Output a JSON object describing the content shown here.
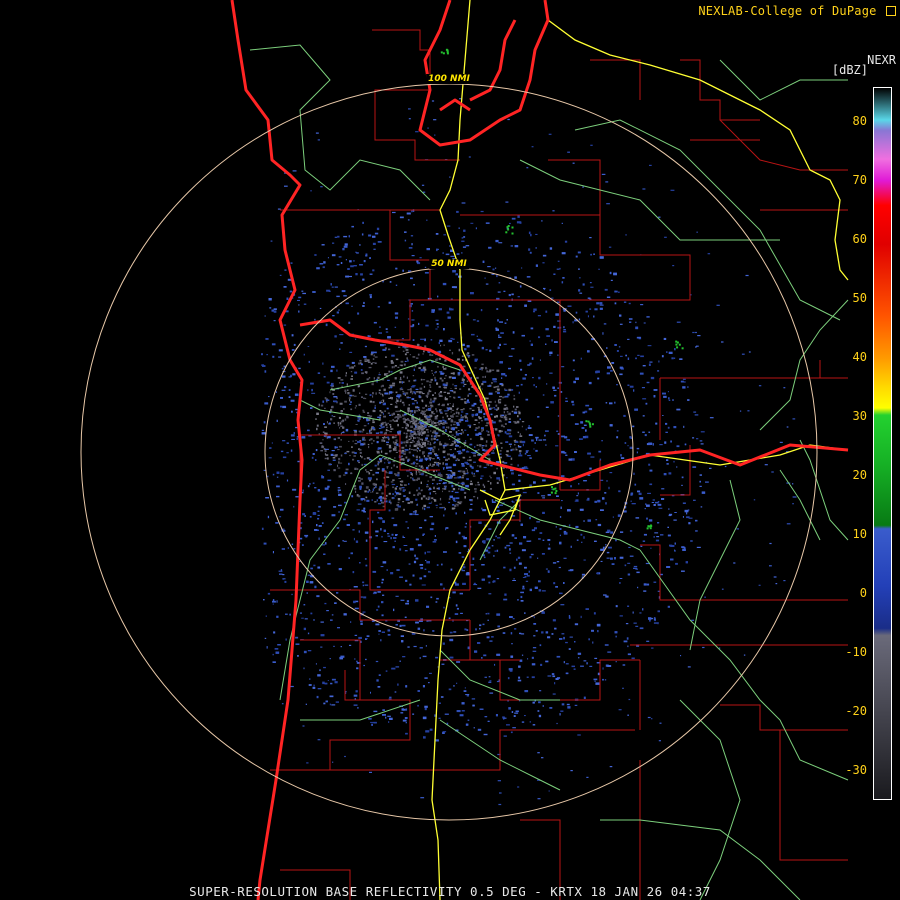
{
  "credit": "NEXLAB-College of DuPage",
  "credit_icon": "external-link-icon",
  "product_code": "NEXR",
  "unit": "[dBZ]",
  "caption": "SUPER-RESOLUTION BASE REFLECTIVITY 0.5 DEG - KRTX 18 JAN 26 04:37",
  "range_rings": [
    {
      "label": "100 NMI"
    },
    {
      "label": "50 NMI"
    }
  ],
  "colorbar_ticks": [
    "80",
    "70",
    "60",
    "50",
    "40",
    "30",
    "20",
    "10",
    "0",
    "-10",
    "-20",
    "-30"
  ],
  "colors": {
    "state_county_borders": "#cc1111",
    "coastline": "#ff2222",
    "interstates": "#ffff33",
    "highways": "#88dd88",
    "range_rings": "#e8c8a8",
    "reflectivity_low": "#3a5ccc",
    "reflectivity_clutter": "#6a6a7a"
  }
}
